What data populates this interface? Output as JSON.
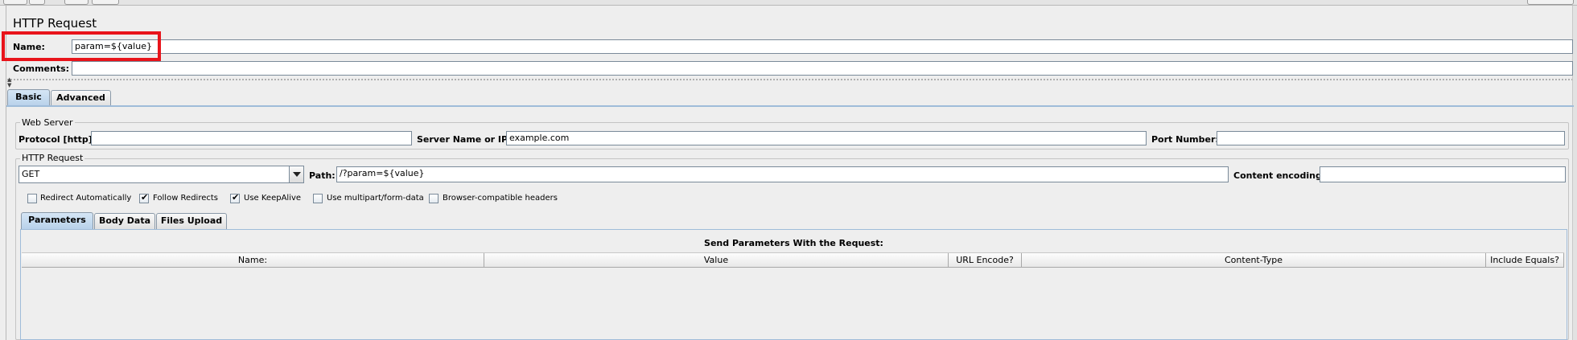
{
  "title": "HTTP Request",
  "name_label": "Name:",
  "name_value": "param=${value}",
  "comments_label": "Comments:",
  "comments_value": "",
  "tabs": [
    {
      "label": "Basic",
      "active": true
    },
    {
      "label": "Advanced",
      "active": false
    }
  ],
  "web_server": {
    "group_title": "Web Server",
    "protocol_label": "Protocol [http]:",
    "protocol_value": "",
    "server_label": "Server Name or IP:",
    "server_value": "example.com",
    "port_label": "Port Number:",
    "port_value": ""
  },
  "http_request": {
    "group_title": "HTTP Request",
    "method": "GET",
    "path_label": "Path:",
    "path_value": "/?param=${value}",
    "encoding_label": "Content encoding:",
    "encoding_value": ""
  },
  "options": [
    {
      "label": "Redirect Automatically",
      "checked": false
    },
    {
      "label": "Follow Redirects",
      "checked": true
    },
    {
      "label": "Use KeepAlive",
      "checked": true
    },
    {
      "label": "Use multipart/form-data",
      "checked": false
    },
    {
      "label": "Browser-compatible headers",
      "checked": false
    }
  ],
  "sub_tabs": [
    {
      "label": "Parameters",
      "active": true
    },
    {
      "label": "Body Data",
      "active": false
    },
    {
      "label": "Files Upload",
      "active": false
    }
  ],
  "params_table": {
    "title": "Send Parameters With the Request:",
    "columns": [
      "Name:",
      "Value",
      "URL Encode?",
      "Content-Type",
      "Include Equals?"
    ],
    "rows": []
  },
  "colors": {
    "highlight": "#e8141b",
    "active_tab": "#b8d1ea",
    "background": "#eeeeee"
  },
  "checkmark_glyph": "✔"
}
